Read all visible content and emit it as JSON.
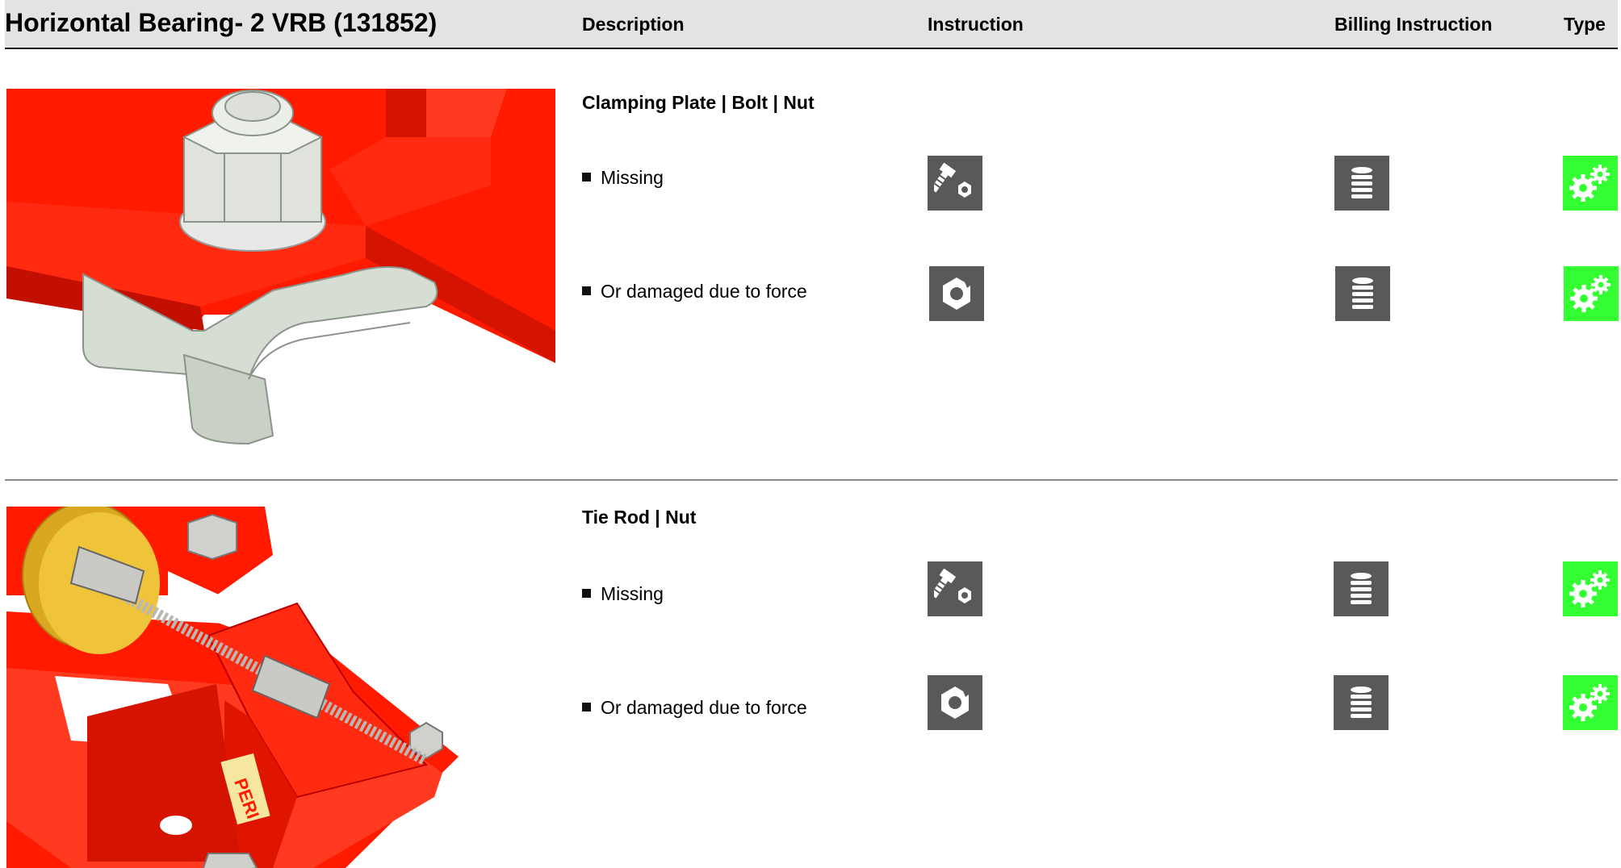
{
  "header": {
    "title": "Horizontal Bearing- 2 VRB (131852)",
    "col_description": "Description",
    "col_instruction": "Instruction",
    "col_billing": "Billing Instruction",
    "col_type": "Type"
  },
  "sections": [
    {
      "group_title": "Clamping Plate | Bolt | Nut",
      "items": [
        {
          "text": "Missing",
          "instruction_icon": "bolt-nut-icon",
          "billing_icon": "coin-stack-icon",
          "type_icon": "gears-icon"
        },
        {
          "text": "Or damaged due to force",
          "instruction_icon": "damaged-nut-icon",
          "billing_icon": "coin-stack-icon",
          "type_icon": "gears-icon"
        }
      ]
    },
    {
      "group_title": "Tie Rod | Nut",
      "items": [
        {
          "text": "Missing",
          "instruction_icon": "bolt-nut-icon",
          "billing_icon": "coin-stack-icon",
          "type_icon": "gears-icon"
        },
        {
          "text": "Or damaged due to force",
          "instruction_icon": "damaged-nut-icon",
          "billing_icon": "coin-stack-icon",
          "type_icon": "gears-icon"
        }
      ]
    }
  ],
  "photo2_label": "PERI",
  "colors": {
    "header_bg": "#e3e3e3",
    "icon_gray": "#595959",
    "type_green": "#33ff33",
    "part_red": "#ff1a00",
    "metal_gray": "#d9ddd8"
  }
}
